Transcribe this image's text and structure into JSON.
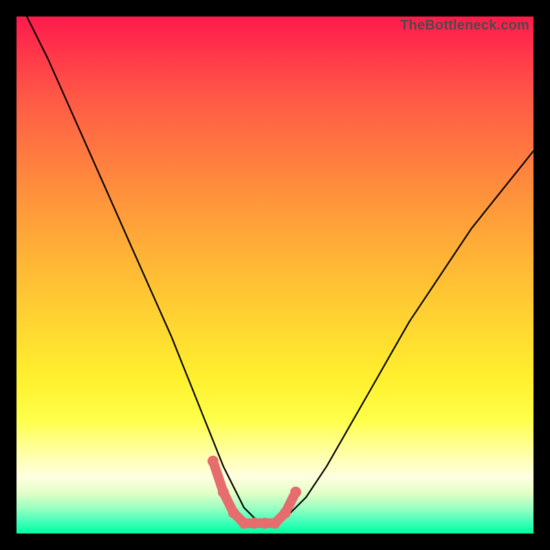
{
  "watermark": "TheBottleneck.com",
  "colors": {
    "frame": "#000000",
    "gradient_top": "#ff1a4c",
    "gradient_bottom": "#00ff9e",
    "curve_main": "#000000",
    "curve_highlight": "#e56d6d"
  },
  "chart_data": {
    "type": "line",
    "title": "",
    "xlabel": "",
    "ylabel": "",
    "xlim": [
      0,
      100
    ],
    "ylim": [
      0,
      100
    ],
    "grid": false,
    "legend": false,
    "annotations": [],
    "series": [
      {
        "name": "main-curve",
        "x": [
          2,
          6,
          10,
          14,
          18,
          22,
          26,
          30,
          32,
          34,
          36,
          38,
          40,
          42,
          44,
          46,
          48,
          50,
          52,
          56,
          60,
          64,
          68,
          72,
          76,
          80,
          84,
          88,
          92,
          96,
          100
        ],
        "y": [
          100,
          92,
          83,
          74,
          65,
          56,
          47,
          38,
          33,
          28,
          23,
          18,
          13,
          9,
          5,
          3,
          2,
          2,
          3,
          7,
          13,
          20,
          27,
          34,
          41,
          47,
          53,
          59,
          64,
          69,
          74
        ]
      },
      {
        "name": "highlight-segment",
        "x": [
          38,
          40,
          42,
          44,
          46,
          48,
          50,
          52,
          54
        ],
        "y": [
          14,
          8,
          4,
          2,
          2,
          2,
          2,
          4,
          8
        ]
      }
    ]
  }
}
